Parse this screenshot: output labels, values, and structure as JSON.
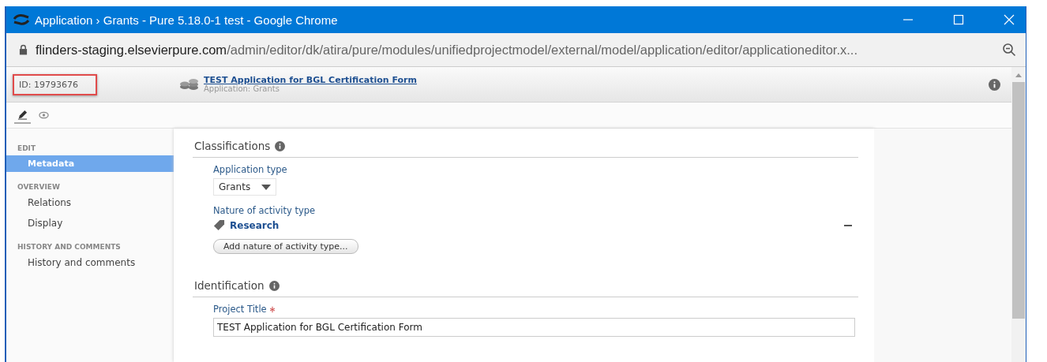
{
  "window": {
    "title": "Application › Grants - Pure 5.18.0-1 test - Google Chrome"
  },
  "address_bar": {
    "url_host": "flinders-staging.elsevierpure.com",
    "url_path": "/admin/editor/dk/atira/pure/modules/unifiedprojectmodel/external/model/application/editor/applicationeditor.x..."
  },
  "header": {
    "id": "ID: 19793676",
    "title": "TEST Application for BGL Certification Form",
    "subtitle": "Application: Grants"
  },
  "mode_tabs": [
    {
      "kind": "edit",
      "selected": true
    },
    {
      "kind": "view",
      "selected": false
    }
  ],
  "sidebar": [
    {
      "heading": "EDIT",
      "items": [
        {
          "label": "Metadata",
          "selected": true
        }
      ]
    },
    {
      "heading": "OVERVIEW",
      "items": [
        {
          "label": "Relations",
          "selected": false
        },
        {
          "label": "Display",
          "selected": false
        }
      ]
    },
    {
      "heading": "HISTORY AND COMMENTS",
      "items": [
        {
          "label": "History and comments",
          "selected": false
        }
      ]
    }
  ],
  "sections": [
    {
      "title": "Classifications",
      "fields": [
        {
          "kind": "dropdown",
          "label": "Application type",
          "value": "Grants"
        },
        {
          "kind": "tags",
          "label": "Nature of activity type",
          "tags": [
            "Research"
          ],
          "add_button": "Add nature of activity type..."
        }
      ]
    },
    {
      "title": "Identification",
      "fields": [
        {
          "kind": "text",
          "label": "Project Title",
          "required": true,
          "value": "TEST Application for BGL Certification Form"
        }
      ]
    }
  ]
}
